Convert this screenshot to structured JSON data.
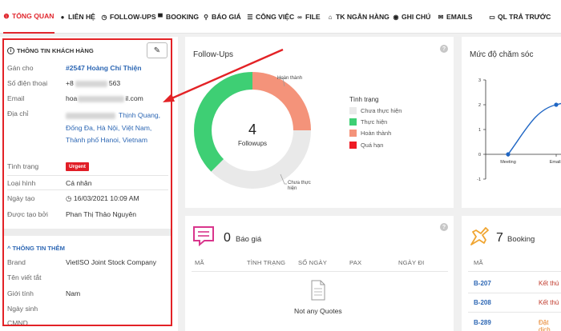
{
  "nav": {
    "tabs": [
      {
        "label": "TỔNG QUAN",
        "icon": "info-circle-icon"
      },
      {
        "label": "LIÊN HỆ",
        "icon": "user-icon"
      },
      {
        "label": "FOLLOW-UPS",
        "icon": "clock-icon"
      },
      {
        "label": "BOOKING",
        "icon": "cart-icon"
      },
      {
        "label": "BÁO GIÁ",
        "icon": "search-icon"
      },
      {
        "label": "CÔNG VIỆC",
        "icon": "task-list-icon"
      },
      {
        "label": "FILE",
        "icon": "link-icon"
      },
      {
        "label": "TK NGÂN HÀNG",
        "icon": "bank-icon"
      },
      {
        "label": "GHI CHÚ",
        "icon": "comment-icon"
      },
      {
        "label": "EMAILS",
        "icon": "envelope-icon"
      },
      {
        "label": "QL TRẢ TRƯỚC",
        "icon": "credit-card-icon"
      }
    ],
    "accent": "#e0262d"
  },
  "customer": {
    "section_title": "THÔNG TIN KHÁCH HÀNG",
    "fields": {
      "assigned_label": "Gán cho",
      "assigned_value": "#2547 Hoàng Chí Thiện",
      "phone_label": "Số điện thoại",
      "phone_prefix": "+8",
      "phone_suffix": "563",
      "email_label": "Email",
      "email_prefix": "hoa",
      "email_suffix": "il.com",
      "address_label": "Địa chỉ",
      "address_value": "Thịnh Quang, Đống Đa, Hà Nội, Việt Nam, Thành phố Hanoi, Vietnam",
      "status_label": "Tình trạng",
      "status_value": "Urgent",
      "type_label": "Loại hình",
      "type_value": "Cá nhân",
      "created_label": "Ngày tạo",
      "created_value": "16/03/2021 10:09 AM",
      "created_by_label": "Được tạo bởi",
      "created_by_value": "Phan Thị Thảo Nguyên"
    },
    "more_title": "THÔNG TIN THÊM",
    "more": {
      "brand_label": "Brand",
      "brand_value": "VietISO Joint Stock Company",
      "abbr_label": "Tên viết tắt",
      "gender_label": "Giới tính",
      "gender_value": "Nam",
      "dob_label": "Ngày sinh",
      "cmnd_label": "CMND"
    }
  },
  "followups": {
    "title": "Follow-Ups",
    "center_number": "4",
    "center_label": "Followups",
    "callout_top": "Hoàn thành",
    "callout_bottom_1": "Chưa thực",
    "callout_bottom_2": "hiện",
    "legend_title": "Tình trạng",
    "legend": [
      {
        "label": "Chưa thực hiện",
        "color": "#e9e9e9"
      },
      {
        "label": "Thực hiện",
        "color": "#3ecf74"
      },
      {
        "label": "Hoàn thành",
        "color": "#f4937a"
      },
      {
        "label": "Quá hạn",
        "color": "#ee1b24"
      }
    ]
  },
  "care": {
    "title": "Mức độ chăm sóc"
  },
  "chart_data": {
    "type": "line",
    "title": "Mức độ chăm sóc",
    "categories": [
      "Meeting",
      "Emails"
    ],
    "values": [
      0,
      2
    ],
    "ylim": [
      -1,
      3
    ],
    "yticks": [
      "3",
      "2",
      "1",
      "0",
      "-1"
    ],
    "xticks": [
      "Meeting",
      "Emails"
    ],
    "color": "#1f66c4"
  },
  "quotes": {
    "count": "0",
    "label": "Báo giá",
    "columns": [
      "MÃ",
      "TÌNH TRẠNG",
      "SỐ NGÀY",
      "PAX",
      "NGÀY ĐI"
    ],
    "empty_text": "Not any Quotes"
  },
  "booking": {
    "count": "7",
    "label": "Booking",
    "column": "MÃ",
    "rows": [
      {
        "code": "B-207",
        "status": "Kết thú",
        "color": "#c0392b"
      },
      {
        "code": "B-208",
        "status": "Kết thú",
        "color": "#c0392b"
      },
      {
        "code": "B-289",
        "status": "Đặt dịch",
        "color": "#e67e22"
      }
    ]
  }
}
